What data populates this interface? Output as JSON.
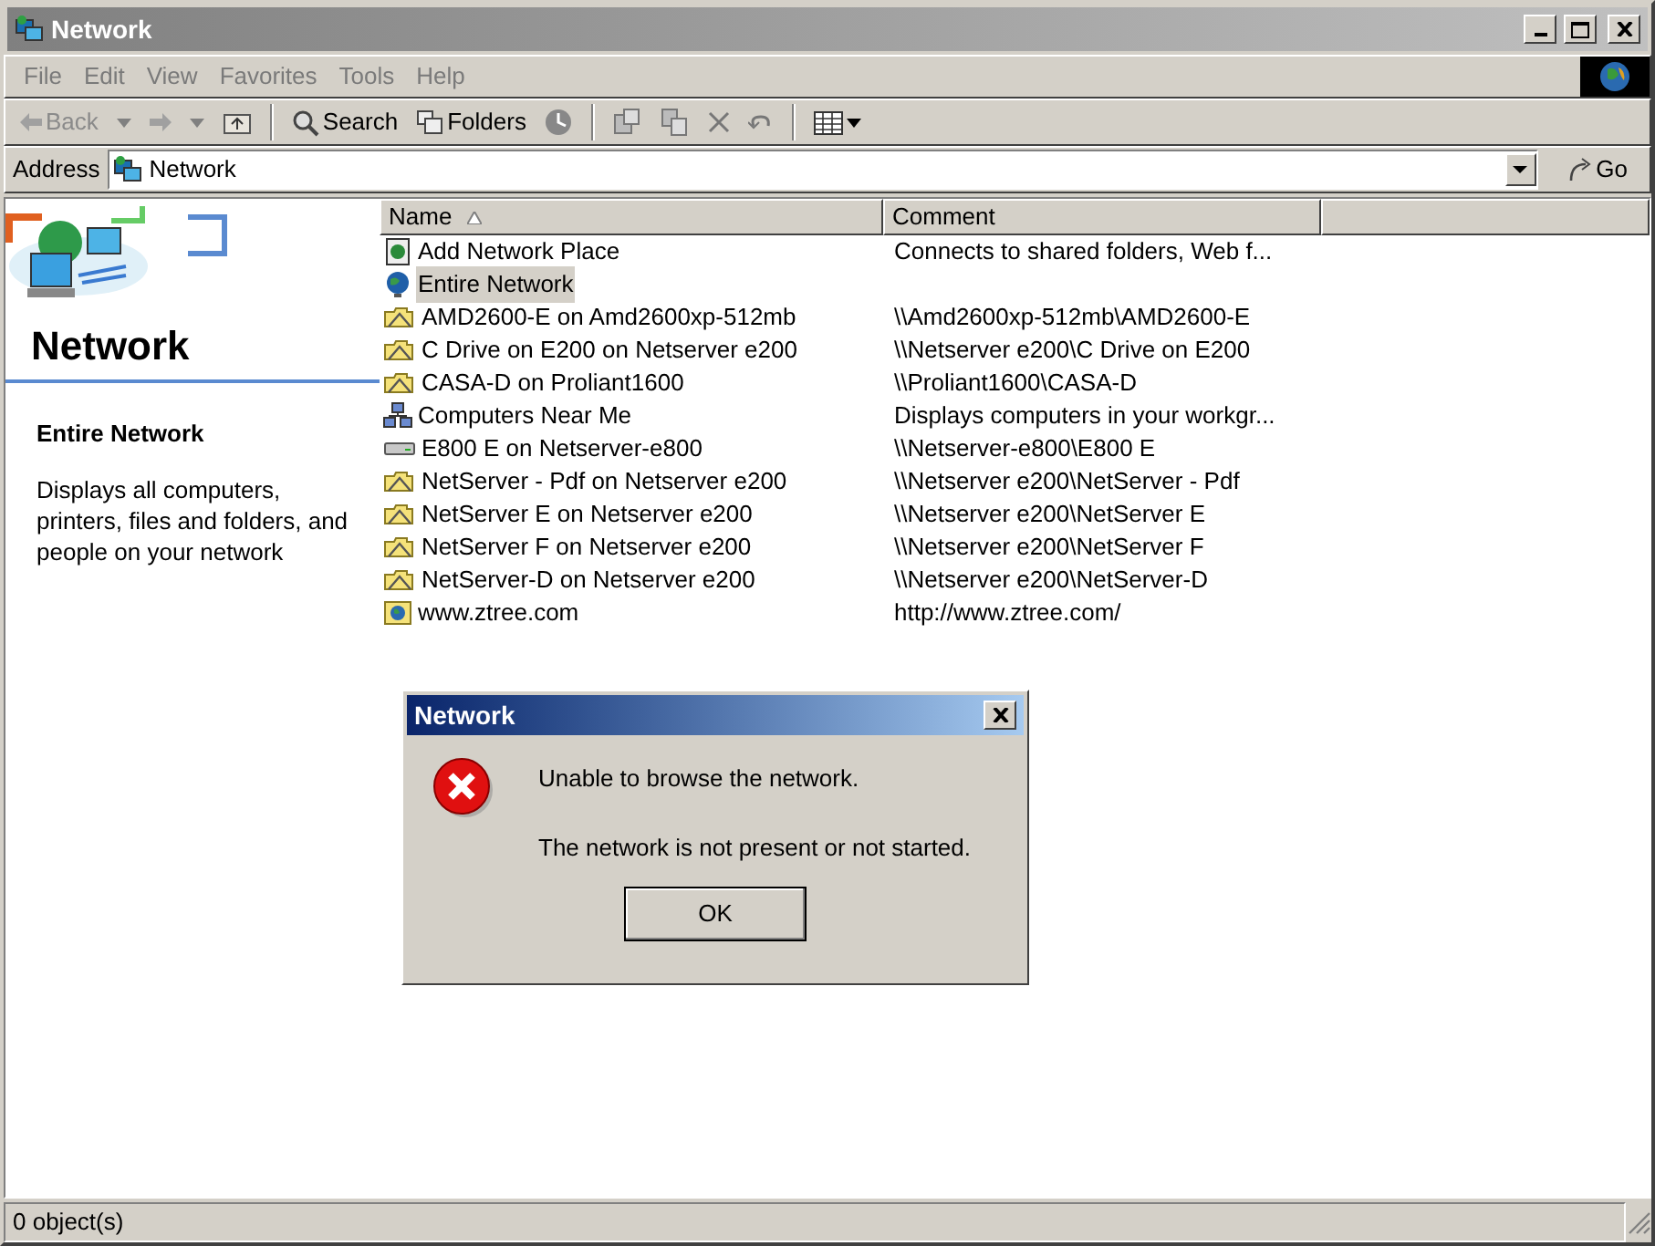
{
  "window": {
    "title": "Network"
  },
  "menu": [
    "File",
    "Edit",
    "View",
    "Favorites",
    "Tools",
    "Help"
  ],
  "toolbar": {
    "back": "Back",
    "search": "Search",
    "folders": "Folders"
  },
  "address": {
    "label": "Address",
    "value": "Network",
    "go": "Go"
  },
  "sidebar": {
    "title": "Network",
    "item_title": "Entire Network",
    "description": "Displays all computers, printers, files and folders, and people on your network"
  },
  "table": {
    "columns": [
      "Name",
      "Comment"
    ],
    "rows": [
      {
        "kind": "add",
        "name": "Add Network Place",
        "comment": "Connects to shared folders, Web f...",
        "selected": false
      },
      {
        "kind": "globe",
        "name": "Entire Network",
        "selected": true
      },
      {
        "kind": "share",
        "name": "AMD2600-E on Amd2600xp-512mb",
        "comment": "\\\\Amd2600xp-512mb\\AMD2600-E",
        "selected": false
      },
      {
        "kind": "share",
        "name": "C Drive on E200 on Netserver e200",
        "comment": "\\\\Netserver e200\\C Drive on E200",
        "selected": false
      },
      {
        "kind": "share",
        "name": "CASA-D on Proliant1600",
        "comment": "\\\\Proliant1600\\CASA-D",
        "selected": false
      },
      {
        "kind": "computers",
        "name": "Computers Near Me",
        "comment": "Displays computers in your workgr...",
        "selected": false
      },
      {
        "kind": "drive",
        "name": "E800 E on Netserver-e800",
        "comment": "\\\\Netserver-e800\\E800 E",
        "selected": false
      },
      {
        "kind": "share",
        "name": "NetServer - Pdf on Netserver e200",
        "comment": "\\\\Netserver e200\\NetServer - Pdf",
        "selected": false
      },
      {
        "kind": "share",
        "name": "NetServer E on Netserver e200",
        "comment": "\\\\Netserver e200\\NetServer E",
        "selected": false
      },
      {
        "kind": "share",
        "name": "NetServer F on Netserver e200",
        "comment": "\\\\Netserver e200\\NetServer F",
        "selected": false
      },
      {
        "kind": "share",
        "name": "NetServer-D on Netserver e200",
        "comment": "\\\\Netserver e200\\NetServer-D",
        "selected": false
      },
      {
        "kind": "web",
        "name": "www.ztree.com",
        "comment": "http://www.ztree.com/",
        "selected": false
      }
    ]
  },
  "dialog": {
    "title": "Network",
    "message": "Unable to browse the network.",
    "detail": "The network is not present or not started.",
    "button": "OK"
  },
  "status_bar": "0 object(s)"
}
